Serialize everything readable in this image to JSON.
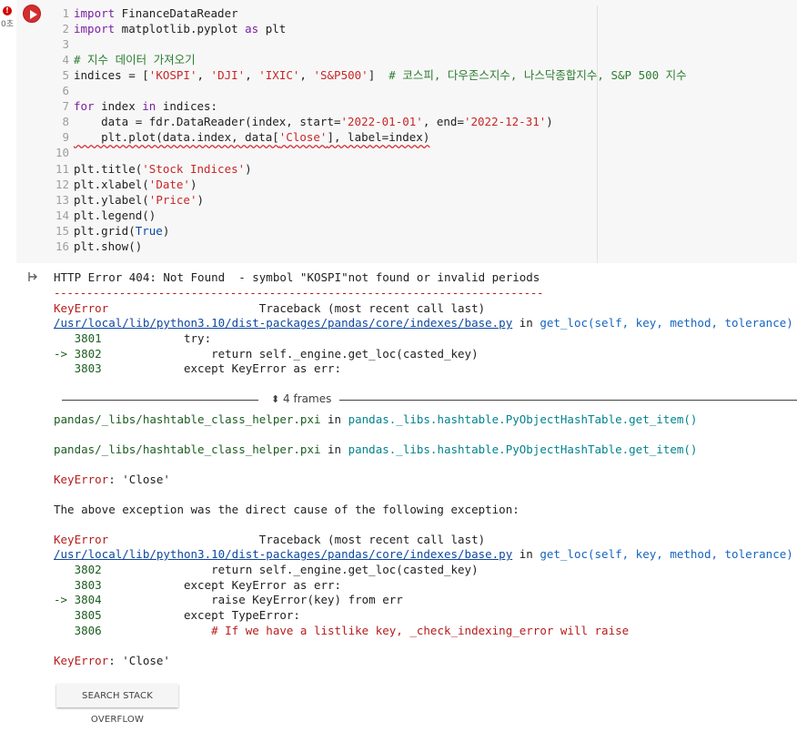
{
  "cell": {
    "error_badge": "!",
    "exec_time": "0초",
    "code_lines": [
      {
        "n": "1",
        "t": "import FinanceDataReader"
      },
      {
        "n": "2",
        "t": "import matplotlib.pyplot as plt"
      },
      {
        "n": "3",
        "t": ""
      },
      {
        "n": "4",
        "t": "# 지수 데이터 가져오기"
      },
      {
        "n": "5",
        "t": "indices = ['KOSPI', 'DJI', 'IXIC', 'S&P500']  # 코스피, 다우존스지수, 나스닥종합지수, S&P 500 지수"
      },
      {
        "n": "6",
        "t": ""
      },
      {
        "n": "7",
        "t": "for index in indices:"
      },
      {
        "n": "8",
        "t": "    data = fdr.DataReader(index, start='2022-01-01', end='2022-12-31')"
      },
      {
        "n": "9",
        "t": "    plt.plot(data.index, data['Close'], label=index)"
      },
      {
        "n": "10",
        "t": ""
      },
      {
        "n": "11",
        "t": "plt.title('Stock Indices')"
      },
      {
        "n": "12",
        "t": "plt.xlabel('Date')"
      },
      {
        "n": "13",
        "t": "plt.ylabel('Price')"
      },
      {
        "n": "14",
        "t": "plt.legend()"
      },
      {
        "n": "15",
        "t": "plt.grid(True)"
      },
      {
        "n": "16",
        "t": "plt.show()"
      }
    ]
  },
  "output": {
    "http_error": "HTTP Error 404: Not Found  - symbol \"KOSPI\"not found or invalid periods",
    "dash_line": "---------------------------------------------------------------------------",
    "tb1": {
      "err_name": "KeyError",
      "header": "Traceback (most recent call last)",
      "path": "/usr/local/lib/python3.10/dist-packages/pandas/core/indexes/base.py",
      "in": " in ",
      "func": "get_loc(self, key, method, tolerance)",
      "lines": [
        {
          "arrow": "   ",
          "num": "3801",
          "code": "            try:"
        },
        {
          "arrow": "-> ",
          "num": "3802",
          "code": "                return self._engine.get_loc(casted_key)"
        },
        {
          "arrow": "   ",
          "num": "3803",
          "code": "            except KeyError as err:"
        }
      ]
    },
    "frames_label": "4 frames",
    "pxi1_path": "pandas/_libs/hashtable_class_helper.pxi",
    "pxi1_func": "pandas._libs.hashtable.PyObjectHashTable.get_item()",
    "pxi2_path": "pandas/_libs/hashtable_class_helper.pxi",
    "pxi2_func": "pandas._libs.hashtable.PyObjectHashTable.get_item()",
    "keyerror1_name": "KeyError",
    "keyerror1_msg": ": 'Close'",
    "cause_text": "The above exception was the direct cause of the following exception:",
    "tb2": {
      "err_name": "KeyError",
      "header": "Traceback (most recent call last)",
      "path": "/usr/local/lib/python3.10/dist-packages/pandas/core/indexes/base.py",
      "in": " in ",
      "func": "get_loc(self, key, method, tolerance)",
      "lines": [
        {
          "arrow": "   ",
          "num": "3802",
          "code": "                return self._engine.get_loc(casted_key)"
        },
        {
          "arrow": "   ",
          "num": "3803",
          "code": "            except KeyError as err:"
        },
        {
          "arrow": "-> ",
          "num": "3804",
          "code": "                raise KeyError(key) from err"
        },
        {
          "arrow": "   ",
          "num": "3805",
          "code": "            except TypeError:"
        },
        {
          "arrow": "   ",
          "num": "3806",
          "code": "                # If we have a listlike key, _check_indexing_error will raise"
        }
      ]
    },
    "keyerror2_name": "KeyError",
    "keyerror2_msg": ": 'Close'",
    "so_button": "SEARCH STACK OVERFLOW"
  }
}
